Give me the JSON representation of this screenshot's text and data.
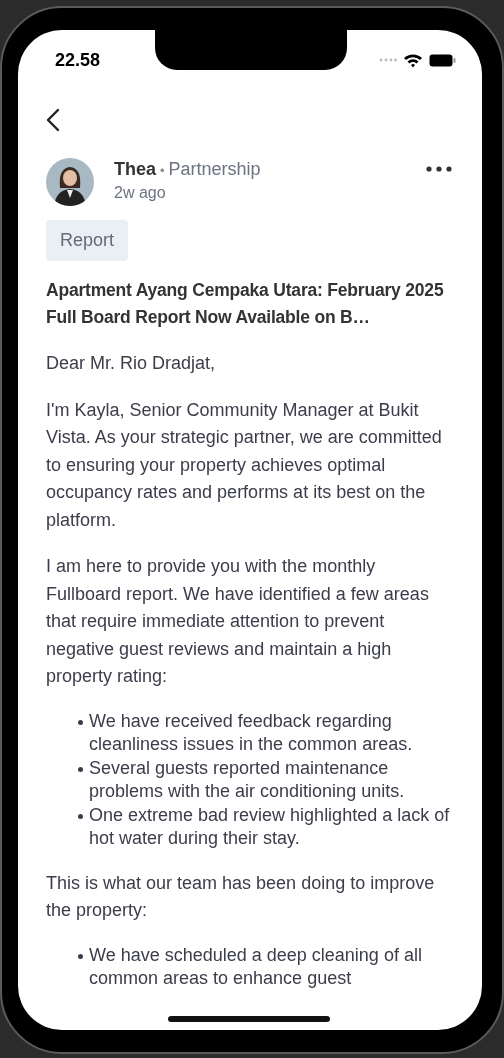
{
  "status_bar": {
    "time": "22.58"
  },
  "post": {
    "author": "Thea",
    "separator": "•",
    "category": "Partnership",
    "time": "2w ago",
    "tag": "Report",
    "title": "Apartment Ayang Cempaka Utara: February 2025 Full Board Report Now Available on B…",
    "body": [
      {
        "kind": "paragraph",
        "text": "Dear Mr. Rio Dradjat,"
      },
      {
        "kind": "paragraph",
        "text": "I'm Kayla, Senior Community Manager at Bukit Vista. As your strategic partner, we are committed to ensuring your property achieves optimal occupancy rates and performs at its best on the platform."
      },
      {
        "kind": "paragraph",
        "text": "I am here to provide you with the monthly Fullboard report. We have identified a few areas that require immediate attention to prevent negative guest reviews and maintain a high property rating:"
      },
      {
        "kind": "list",
        "items": [
          "We have received feedback regarding cleanliness issues in the common areas.",
          "Several guests reported maintenance problems with the air conditioning units.",
          "One extreme bad review highlighted a lack of hot water during their stay."
        ]
      },
      {
        "kind": "paragraph",
        "text": "This is what our team has been doing to improve the property:"
      },
      {
        "kind": "list",
        "items": [
          "We have scheduled a deep cleaning of all common areas to enhance guest"
        ]
      }
    ]
  }
}
